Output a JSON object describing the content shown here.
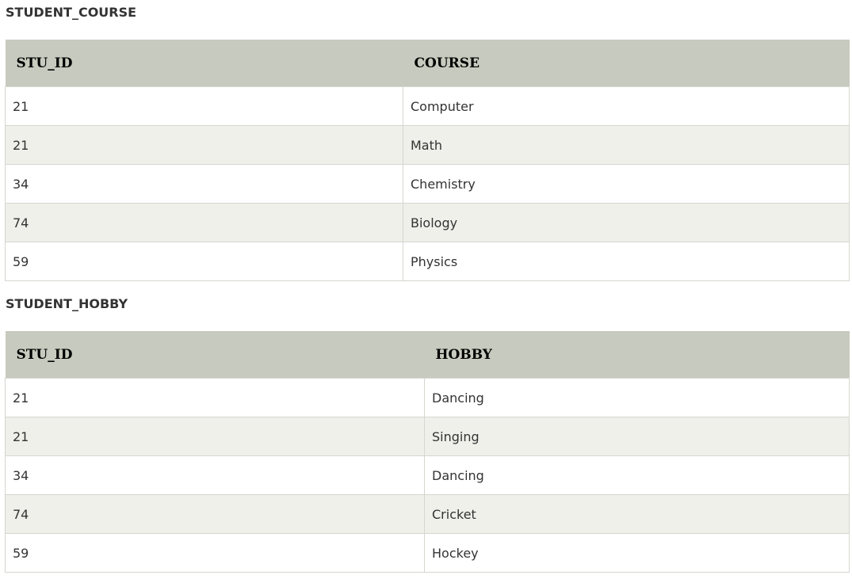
{
  "student_course": {
    "caption": "STUDENT_COURSE",
    "headers": [
      "STU_ID",
      "COURSE"
    ],
    "rows": [
      [
        "21",
        "Computer"
      ],
      [
        "21",
        "Math"
      ],
      [
        "34",
        "Chemistry"
      ],
      [
        "74",
        "Biology"
      ],
      [
        "59",
        "Physics"
      ]
    ]
  },
  "student_hobby": {
    "caption": "STUDENT_HOBBY",
    "headers": [
      "STU_ID",
      "HOBBY"
    ],
    "rows": [
      [
        "21",
        "Dancing"
      ],
      [
        "21",
        "Singing"
      ],
      [
        "34",
        "Dancing"
      ],
      [
        "74",
        "Cricket"
      ],
      [
        "59",
        "Hockey"
      ]
    ]
  },
  "colors": {
    "header_bg": "#c7cabe",
    "row_alt_bg": "#eef0e9",
    "border": "#d6d6d0"
  }
}
